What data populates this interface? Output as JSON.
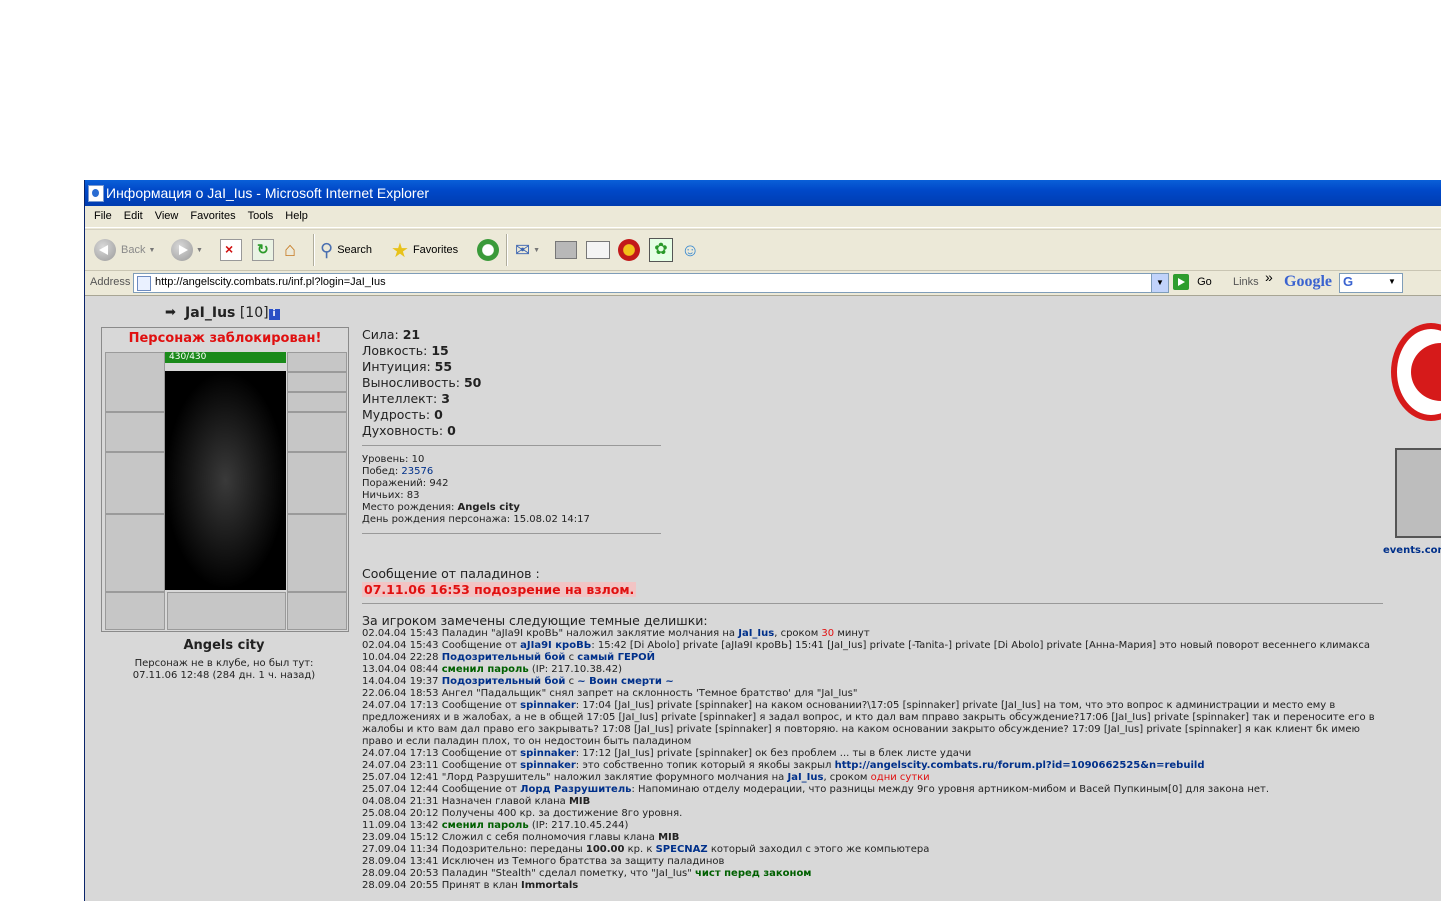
{
  "window": {
    "title": "Информация о JaI_Ius - Microsoft Internet Explorer"
  },
  "menu": [
    "File",
    "Edit",
    "View",
    "Favorites",
    "Tools",
    "Help"
  ],
  "toolbar": {
    "back": "Back",
    "search": "Search",
    "favorites": "Favorites"
  },
  "addressbar": {
    "label": "Address",
    "url": "http://angelscity.combats.ru/inf.pl?login=JaI_Ius",
    "go": "Go",
    "links": "Links",
    "google": "Google"
  },
  "character": {
    "name": "JaI_Ius",
    "level": "[10]",
    "blocked": "Персонаж заблокирован!",
    "hp": "430/430",
    "city": "Angels city",
    "last_seen_1": "Персонаж не в клубе, но был тут:",
    "last_seen_2": "07.11.06 12:48 (284 дн. 1 ч. назад)"
  },
  "stats": [
    {
      "label": "Сила: ",
      "value": "21"
    },
    {
      "label": "Ловкость: ",
      "value": "15"
    },
    {
      "label": "Интуиция: ",
      "value": "55"
    },
    {
      "label": "Выносливость: ",
      "value": "50"
    },
    {
      "label": "Интеллект: ",
      "value": "3"
    },
    {
      "label": "Мудрость: ",
      "value": "0"
    },
    {
      "label": "Духовность: ",
      "value": "0"
    }
  ],
  "details": {
    "level": "Уровень: 10",
    "wins_label": "Побед: ",
    "wins": "23576",
    "losses": "Поражений: 942",
    "draws": "Ничьих: 83",
    "birthplace_label": "Место рождения: ",
    "birthplace": "Angels city",
    "birthday": "День рождения персонажа: 15.08.02 14:17"
  },
  "paladin": {
    "header": "Сообщение от паладинов :",
    "message": "07.11.06 16:53 подозрение на взлом."
  },
  "dark_deeds_header": "За игроком замечены следующие темные делишки:",
  "log": [
    [
      {
        "t": "02.04.04 15:43 Паладин \"аJIа9I кроВЬ\" наложил заклятие молчания на "
      },
      {
        "t": "JaI_Ius",
        "c": "b1"
      },
      {
        "t": ", сроком "
      },
      {
        "t": "30",
        "c": "r1"
      },
      {
        "t": " минут"
      }
    ],
    [
      {
        "t": "02.04.04 15:43 Сообщение от "
      },
      {
        "t": "аJIа9I кроВЬ",
        "c": "b1"
      },
      {
        "t": ": 15:42 [Di Abolo] private [аJIа9I кроВЬ] 15:41 [JaI_Ius] private [-Tanita-] private [Di Abolo] private [Анна-Мария] это новый поворот весеннего климакса"
      }
    ],
    [
      {
        "t": "10.04.04 22:28 "
      },
      {
        "t": "Подозрительный бой",
        "c": "b1"
      },
      {
        "t": " с "
      },
      {
        "t": "самый ГЕРОЙ",
        "c": "b1"
      }
    ],
    [
      {
        "t": "13.04.04 08:44 "
      },
      {
        "t": "сменил пароль",
        "c": "g1"
      },
      {
        "t": " (IP: 217.10.38.42)"
      }
    ],
    [
      {
        "t": "14.04.04 19:37 "
      },
      {
        "t": "Подозрительный бой",
        "c": "b1"
      },
      {
        "t": " с "
      },
      {
        "t": "~ Воин смерти ~",
        "c": "b1"
      }
    ],
    [
      {
        "t": "22.06.04 18:53 Ангел \"Падальщик\" снял запрет на склонность 'Темное братство' для \"JaI_Ius\""
      }
    ],
    [
      {
        "t": "24.07.04 17:13 Сообщение от "
      },
      {
        "t": "spinnaker",
        "c": "b1"
      },
      {
        "t": ": 17:04 [JaI_Ius] private [spinnaker] на каком основании?\\17:05 [spinnaker] private [JaI_Ius] на том, что это вопрос к администрации и место ему в предложениях и в жалобах, а не в общей 17:05 [JaI_Ius] private [spinnaker] я задал вопрос, и кто дал вам пправо закрыть обсуждение?17:06 [JaI_Ius] private [spinnaker] так и переносите его в жалобы и кто вам дал право его закрывать? 17:08 [JaI_Ius] private [spinnaker] я повторяю. на каком основании закрыто обсуждение? 17:09 [JaI_Ius] private [spinnaker] я как клиент бк имею право и если паладин плох, то он недостоин быть паладином"
      }
    ],
    [
      {
        "t": "24.07.04 17:13 Сообщение от "
      },
      {
        "t": "spinnaker",
        "c": "b1"
      },
      {
        "t": ": 17:12 [JaI_Ius] private [spinnaker] ок без проблем ... ты в блек листе удачи"
      }
    ],
    [
      {
        "t": "24.07.04 23:11 Сообщение от "
      },
      {
        "t": "spinnaker",
        "c": "b1"
      },
      {
        "t": ": это собственно топик который я якобы закрыл "
      },
      {
        "t": "http://angelscity.combats.ru/forum.pl?id=1090662525&n=rebuild",
        "c": "b1"
      }
    ],
    [
      {
        "t": "25.07.04 12:41 \"Лорд Разрушитель\" наложил заклятие форумного молчания на "
      },
      {
        "t": "JaI_Ius",
        "c": "b1"
      },
      {
        "t": ", сроком "
      },
      {
        "t": "одни сутки",
        "c": "r1"
      }
    ],
    [
      {
        "t": "25.07.04 12:44 Сообщение от "
      },
      {
        "t": "Лорд Разрушитель",
        "c": "b1"
      },
      {
        "t": ": Напоминаю отделу модерации, что разницы между 9го уровня артником-мибом и Васей Пупкиным[0] для закона нет."
      }
    ],
    [
      {
        "t": "04.08.04 21:31 Назначен главой клана "
      },
      {
        "t": "MIB",
        "c": "bb"
      }
    ],
    [
      {
        "t": "25.08.04 20:12 Получены 400 кр. за достижение 8го уровня."
      }
    ],
    [
      {
        "t": "11.09.04 13:42 "
      },
      {
        "t": "сменил пароль",
        "c": "g1"
      },
      {
        "t": " (IP: 217.10.45.244)"
      }
    ],
    [
      {
        "t": "23.09.04 15:12 Сложил с себя полномочия главы клана "
      },
      {
        "t": "MIB",
        "c": "bb"
      }
    ],
    [
      {
        "t": "27.09.04 11:34 Подозрительно: переданы "
      },
      {
        "t": "100.00",
        "c": "bb"
      },
      {
        "t": " кр. к "
      },
      {
        "t": "SPECNAZ",
        "c": "b1"
      },
      {
        "t": " который заходил с этого же компьютера"
      }
    ],
    [
      {
        "t": "28.09.04 13:41 Исключен из Темного братства за защиту паладинов"
      }
    ],
    [
      {
        "t": "28.09.04 20:53 Паладин \"Stealth\" сделал пометку, что \"JaI_Ius\" "
      },
      {
        "t": "чист перед законом",
        "c": "g1"
      }
    ],
    [
      {
        "t": "28.09.04 20:55 Принят в клан "
      },
      {
        "t": "Immortals",
        "c": "bb"
      }
    ]
  ],
  "events_link": "events.com"
}
